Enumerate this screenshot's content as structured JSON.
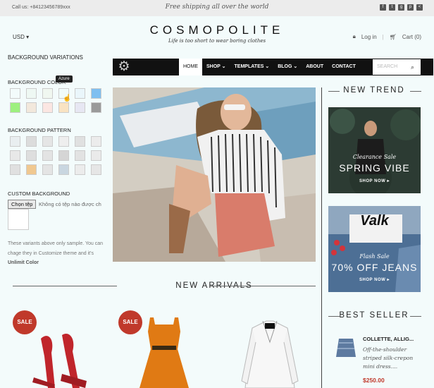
{
  "topbar": {
    "call": "Call us: +84123456789xxx",
    "shipping": "Free shipping all over the world",
    "socials": [
      "facebook-icon",
      "twitter-icon",
      "google-plus-icon",
      "pinterest-icon",
      "share-icon"
    ]
  },
  "header": {
    "currency": "USD ▾",
    "logo": "COSMOPOLITE",
    "tagline": "Life is too short to wear boring clothes",
    "login": "Log in",
    "cart": "Cart (0)"
  },
  "panel": {
    "title": "BACKGROUND VARIATIONS",
    "color_label": "BACKGROUND COLOR",
    "tooltip": "Azure",
    "colors": [
      "#f3fbfb",
      "#eef8f3",
      "#f0f7f0",
      "#f0fbfb",
      "#eaf6fb",
      "#7fbff0",
      "#9df07f",
      "#f2e8dc",
      "#fbe6e2",
      "#f9e3c2",
      "#e7e7f3",
      "#9a9a9a"
    ],
    "pattern_label": "BACKGROUND PATTERN",
    "patterns": [
      "#e9eef0",
      "#dcdcdc",
      "#e5e5e5",
      "#eeeeee",
      "#e0e0e0",
      "#ececec",
      "#e8e8e8",
      "#dedede",
      "#e3e3e3",
      "#d5d5d5",
      "#e2e2e2",
      "#eaeaea",
      "#e0e0e0",
      "#f0c890",
      "#e4e4e4",
      "#c9d6e0",
      "#ececec",
      "#e6e6e6"
    ],
    "custom_label": "CUSTOM BACKGROUND",
    "file_button": "Chọn tệp",
    "file_status": "Không có tệp nào được ch",
    "note": "These variants above only sample. You can chage they in Customize theme and it's",
    "note_bold": "Unlimit Color"
  },
  "nav": {
    "items": [
      {
        "label": "HOME"
      },
      {
        "label": "SHOP ⌄"
      },
      {
        "label": "TEMPLATES ⌄"
      },
      {
        "label": "BLOG ⌄"
      },
      {
        "label": "ABOUT"
      },
      {
        "label": "CONTACT"
      }
    ],
    "search_placeholder": "SEARCH"
  },
  "sidebar": {
    "trend_title": "NEW TREND",
    "banner1": {
      "small": "Clearance Sale",
      "big": "SPRING VIBE",
      "button": "SHOP NOW ▸"
    },
    "banner2": {
      "small": "Flash Sale",
      "big": "70% OFF JEANS",
      "button": "SHOP NOW ▸",
      "print": "Valk"
    },
    "best_title": "BEST SELLER",
    "best_item": {
      "name": "COLLETTE, ALLIG...",
      "desc": "Off-the-shoulder striped silk-crepon mini dress....",
      "price": "$250.00"
    }
  },
  "arrivals": {
    "title": "NEW ARRIVALS",
    "sale_label": "SALE"
  }
}
